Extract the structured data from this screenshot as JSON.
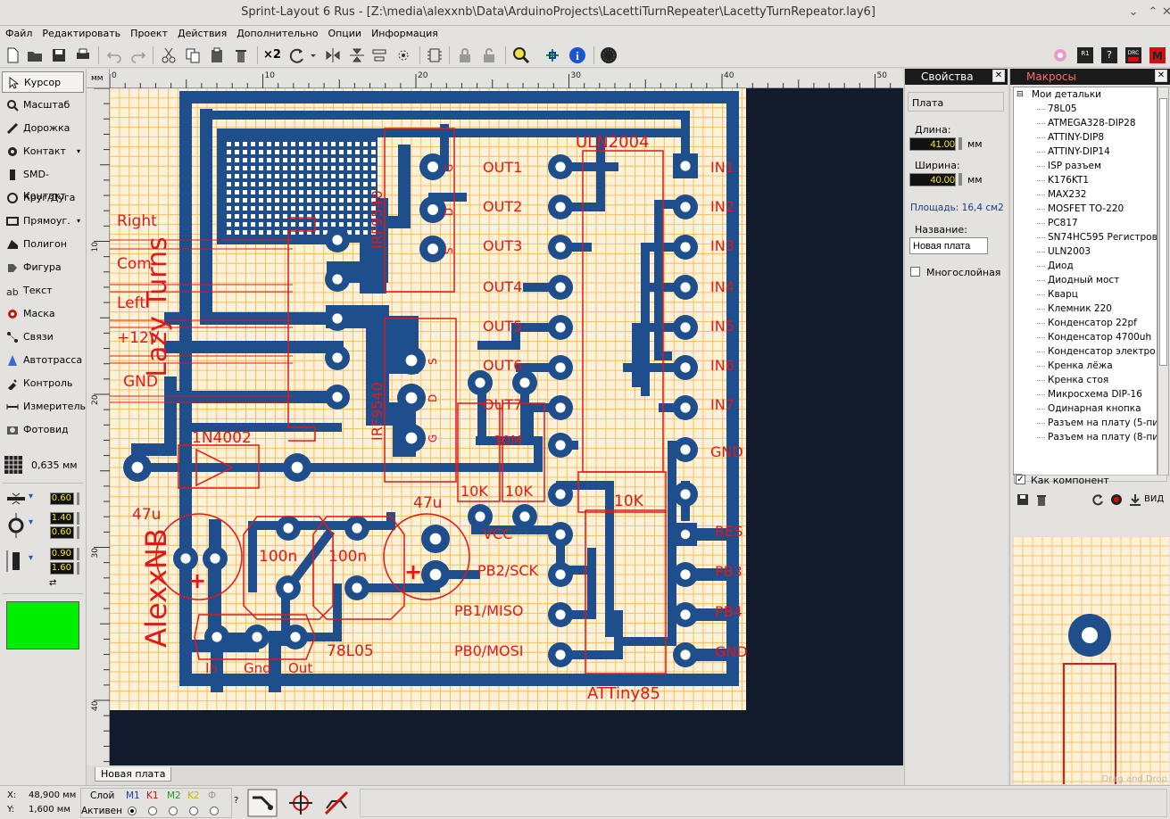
{
  "window": {
    "title": "Sprint-Layout 6 Rus - [Z:\\media\\alexxnb\\Data\\ArduinoProjects\\LacettiTurnRepeater\\LacettyTurnRepeator.lay6]"
  },
  "menu": [
    "Файл",
    "Редактировать",
    "Проект",
    "Действия",
    "Дополнительно",
    "Опции",
    "Информация"
  ],
  "toolbar": {
    "x2_label": "×2"
  },
  "tools": [
    {
      "label": "Курсор",
      "icon": "cursor-icon"
    },
    {
      "label": "Масштаб",
      "icon": "zoom-icon"
    },
    {
      "label": "Дорожка",
      "icon": "track-icon"
    },
    {
      "label": "Контакт",
      "icon": "pad-icon"
    },
    {
      "label": "SMD-Контакт",
      "icon": "smd-pad-icon"
    },
    {
      "label": "Круг/Дуга",
      "icon": "circle-arc-icon"
    },
    {
      "label": "Прямоуг.",
      "icon": "rectangle-icon"
    },
    {
      "label": "Полигон",
      "icon": "polygon-icon"
    },
    {
      "label": "Фигура",
      "icon": "shape-icon"
    },
    {
      "label": "Текст",
      "icon": "text-icon"
    },
    {
      "label": "Маска",
      "icon": "mask-icon"
    },
    {
      "label": "Связи",
      "icon": "connections-icon"
    },
    {
      "label": "Автотрасса",
      "icon": "autoroute-icon"
    },
    {
      "label": "Контроль",
      "icon": "control-icon"
    },
    {
      "label": "Измеритель",
      "icon": "measure-icon"
    },
    {
      "label": "Фотовид",
      "icon": "photoview-icon"
    }
  ],
  "grid": {
    "value": "0,635 мм"
  },
  "widths": {
    "track": "0.60",
    "pad_outer": "1.40",
    "pad_inner": "0.60",
    "smd_w": "0.90",
    "smd_h": "1.60"
  },
  "ruler": {
    "unit": "мм",
    "h_ticks": [
      "0",
      "10",
      "20",
      "30",
      "40",
      "50"
    ],
    "v_ticks": [
      "10",
      "20",
      "30",
      "40"
    ]
  },
  "board": {
    "title_left": "Lazy Turns",
    "author": "AlexxNB",
    "labels": {
      "uln": "ULN2004",
      "attiny": "ATTiny85",
      "irf1": "IRF9540",
      "irf2": "IRF9540",
      "diode": "1N4002",
      "cap1": "47u",
      "cap2": "47u",
      "c100a": "100n",
      "c100b": "100n",
      "reg": "78L05",
      "r1": "10K",
      "r2": "10K",
      "r3": "10K",
      "r4": "10M",
      "in": "In",
      "gnd": "Gnd",
      "out": "Out",
      "right": "Right",
      "com": "Com",
      "left": "Left",
      "v12": "+12V",
      "gnd_wire": "GND",
      "vcc": "VCC",
      "pb2": "PB2/SCK",
      "pb1": "PB1/MISO",
      "pb0": "PB0/MOSI",
      "res": "RES",
      "pb3": "PB3",
      "pb4": "PB4",
      "gnd2": "GND",
      "gnd3": "GND"
    },
    "outs": [
      "OUT1",
      "OUT2",
      "OUT3",
      "OUT4",
      "OUT5",
      "OUT6",
      "OUT7"
    ],
    "ins": [
      "IN1",
      "IN2",
      "IN3",
      "IN4",
      "IN5",
      "IN6",
      "IN7"
    ],
    "pins_g": [
      "G",
      "D",
      "S"
    ],
    "pins_s": [
      "S",
      "D",
      "G"
    ]
  },
  "tab": {
    "label": "Новая плата"
  },
  "properties": {
    "header": "Свойства",
    "section": "Плата",
    "length_label": "Длина:",
    "length_value": "41.00",
    "width_label": "Ширина:",
    "width_value": "40.00",
    "unit": "мм",
    "area": "Площадь: 16,4 см2",
    "name_label": "Название:",
    "name_value": "Новая плата",
    "multilayer_label": "Многослойная"
  },
  "macros": {
    "header": "Макросы",
    "root": "Мои детальки",
    "items": [
      "78L05",
      "ATMEGA328-DIP28",
      "ATTINY-DIP8",
      "ATTINY-DIP14",
      "ISP разъем",
      "K176KT1",
      "MAX232",
      "MOSFET TO-220",
      "PC817",
      "SN74HC595 Регистровый",
      "ULN2003",
      "Диод",
      "Диодный мост",
      "Кварц",
      "Клемник 220",
      "Конденсатор 22pf",
      "Конденсатор 4700uh",
      "Конденсатор электро",
      "Кренка лёжа",
      "Кренка стоя",
      "Микросхема DIP-16",
      "Одинарная кнопка",
      "Разъем на плату (5-пи",
      "Разъем на плату (8-пи"
    ],
    "as_component_label": "Как компонент",
    "view_label": "ВИД",
    "drag_drop": "Drag and Drop"
  },
  "status": {
    "x_label": "X:",
    "x_value": "48,900 мм",
    "y_label": "Y:",
    "y_value": "1,600 мм",
    "layer_label": "Слой",
    "active_label": "Активен",
    "layers": [
      "M1",
      "K1",
      "M2",
      "K2",
      "Ф"
    ],
    "layer_colors": [
      "#1a3ea8",
      "#d01010",
      "#1f9a1f",
      "#c9b300",
      "#999999"
    ],
    "help": "?"
  },
  "colors": {
    "copper": "#1e4e8c",
    "silk": "#e01818",
    "board": "#fdf2d8",
    "grid": "#f6b34a",
    "selection": "#00ee00"
  }
}
